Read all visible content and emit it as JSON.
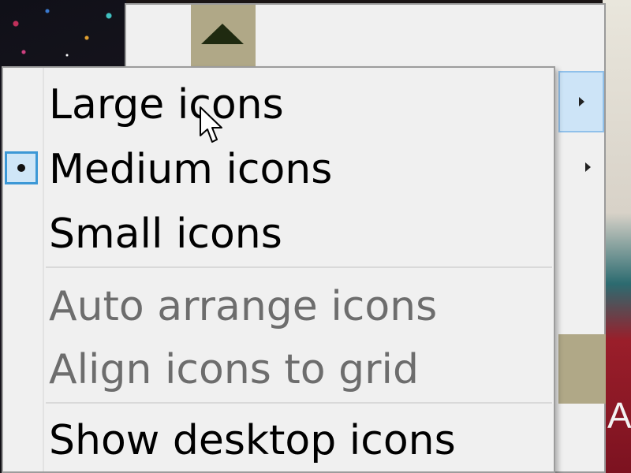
{
  "wallpaper": {
    "right_fragment_text": "AN"
  },
  "background_window": {
    "scroll_up_icon": "triangle-up-icon",
    "submenu_arrow_icon": "chevron-right-icon"
  },
  "context_menu": {
    "items": [
      {
        "label": "Large icons",
        "enabled": true,
        "checked": false
      },
      {
        "label": "Medium icons",
        "enabled": true,
        "checked": true
      },
      {
        "label": "Small icons",
        "enabled": true,
        "checked": false
      },
      {
        "label": "Auto arrange icons",
        "enabled": false,
        "checked": false
      },
      {
        "label": "Align icons to grid",
        "enabled": false,
        "checked": false
      },
      {
        "label": "Show desktop icons",
        "enabled": true,
        "checked": false
      }
    ],
    "checked_marker_icon": "radio-dot-icon"
  },
  "cursor": {
    "icon": "arrow-pointer-icon"
  },
  "colors": {
    "menu_background": "#f0f0f0",
    "disabled_text": "#6d6d6d",
    "check_highlight": "#3c98d6",
    "scroll_button": "#b0a887"
  }
}
